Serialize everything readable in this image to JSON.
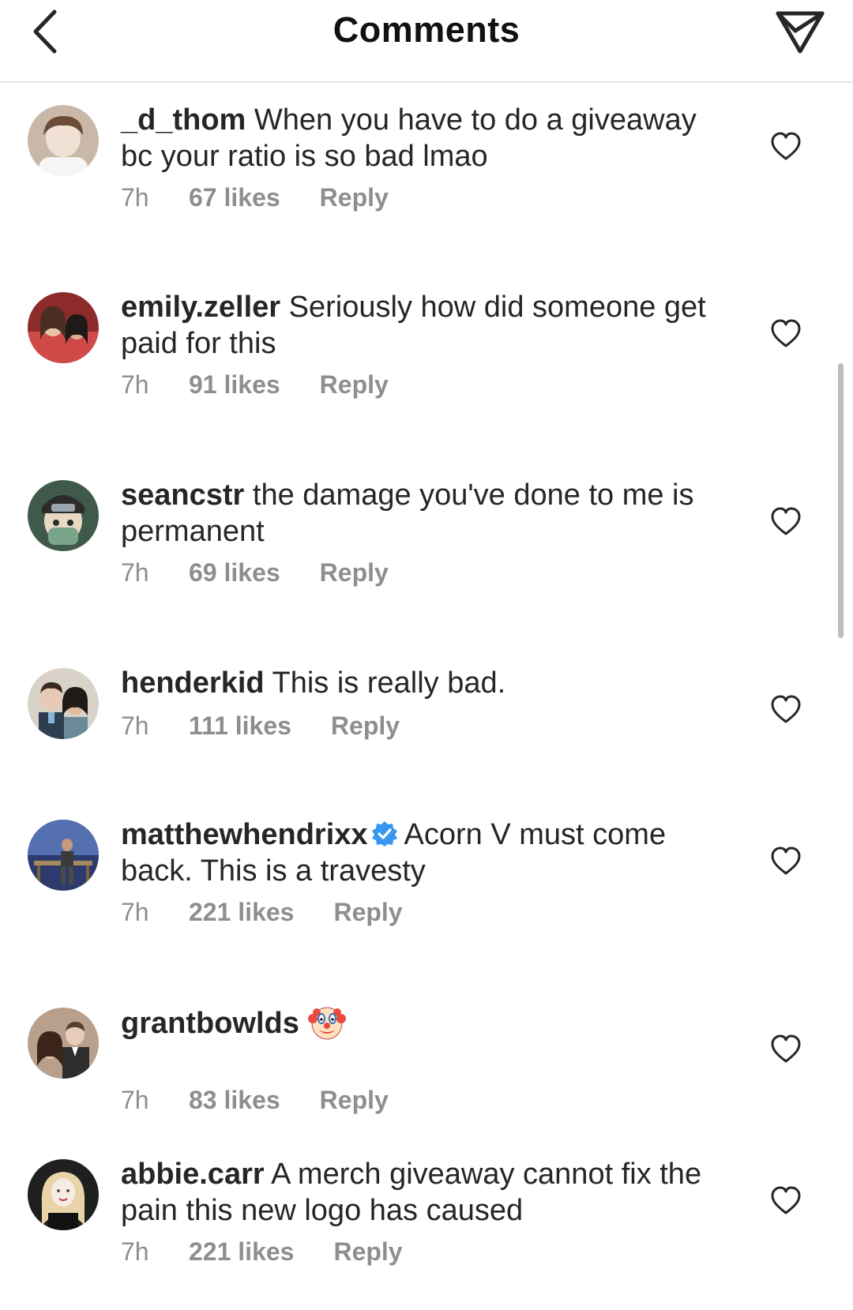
{
  "header": {
    "title": "Comments",
    "back_icon": "chevron-left-icon",
    "send_icon": "paper-plane-icon"
  },
  "comments": [
    {
      "username": "_d_thom",
      "text": "When you have to do a giveaway bc your ratio is so bad lmao",
      "time": "7h",
      "likes": "67 likes",
      "reply": "Reply",
      "verified": false,
      "avatar_colors": [
        "#c9b8a8",
        "#6b4a36",
        "#f1e8e0"
      ]
    },
    {
      "username": "emily.zeller",
      "text": "Seriously how did someone get paid for this",
      "time": "7h",
      "likes": "91 likes",
      "reply": "Reply",
      "verified": false,
      "avatar_colors": [
        "#8d2b2b",
        "#e07a7a",
        "#3b2a22"
      ]
    },
    {
      "username": "seancstr",
      "text": "the damage you've done to me is permanent",
      "time": "7h",
      "likes": "69 likes",
      "reply": "Reply",
      "verified": false,
      "avatar_colors": [
        "#3f5a4a",
        "#7aa58b",
        "#e9d9c4"
      ]
    },
    {
      "username": "henderkid",
      "text": "This is really bad.",
      "time": "7h",
      "likes": "111 likes",
      "reply": "Reply",
      "verified": false,
      "avatar_colors": [
        "#2c3e50",
        "#e8c9b4",
        "#87b5d8"
      ]
    },
    {
      "username": "matthewhendrixx",
      "text": "Acorn V must come back. This is a travesty",
      "time": "7h",
      "likes": "221 likes",
      "reply": "Reply",
      "verified": true,
      "avatar_colors": [
        "#2c3a6e",
        "#5470b0",
        "#a6895c"
      ]
    },
    {
      "username": "grantbowlds",
      "text": "",
      "emoji": "clown-face-emoji",
      "time": "7h",
      "likes": "83 likes",
      "reply": "Reply",
      "verified": false,
      "avatar_colors": [
        "#5a4033",
        "#e7cdb9",
        "#2d2d2d"
      ]
    },
    {
      "username": "abbie.carr",
      "text": "A merch giveaway cannot fix the pain this new logo has caused",
      "time": "7h",
      "likes": "221 likes",
      "reply": "Reply",
      "verified": false,
      "avatar_colors": [
        "#1f1f1f",
        "#e9d3a8",
        "#f5ece3"
      ]
    }
  ],
  "colors": {
    "text": "#262626",
    "meta": "#8e8e8e",
    "verified": "#3897f0",
    "divider": "#e6e6e6"
  }
}
